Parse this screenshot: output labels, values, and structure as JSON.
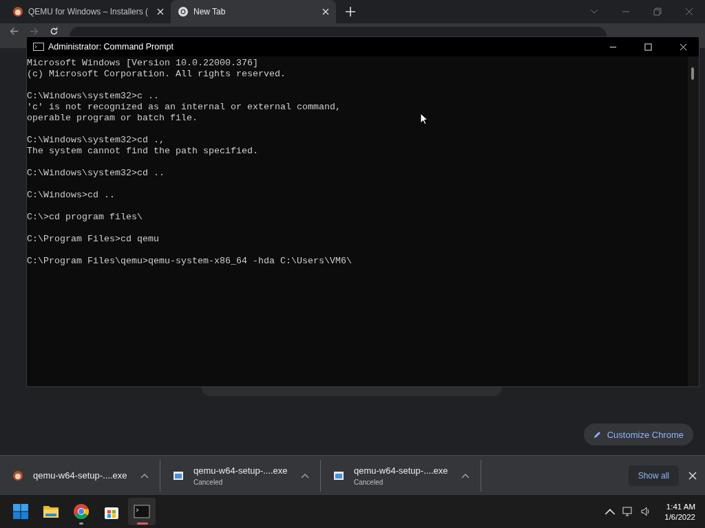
{
  "browser": {
    "tabs": [
      {
        "title": "QEMU for Windows – Installers (",
        "kind": "qemu",
        "selected": false
      },
      {
        "title": "New Tab",
        "kind": "chrome",
        "selected": true
      }
    ],
    "customize_button": "Customize Chrome"
  },
  "console_window": {
    "title": "Administrator: Command Prompt",
    "blocks": [
      [
        "Microsoft Windows [Version 10.0.22000.376]",
        "(c) Microsoft Corporation. All rights reserved."
      ],
      [
        "C:\\Windows\\system32>c ..",
        "'c' is not recognized as an internal or external command,",
        "operable program or batch file."
      ],
      [
        "C:\\Windows\\system32>cd .,",
        "The system cannot find the path specified."
      ],
      [
        "C:\\Windows\\system32>cd .."
      ],
      [
        "C:\\Windows>cd .."
      ],
      [
        "C:\\>cd program files\\"
      ],
      [
        "C:\\Program Files>cd qemu"
      ],
      [
        "C:\\Program Files\\qemu>qemu-system-x86_64 -hda C:\\Users\\VM6\\"
      ]
    ]
  },
  "downloads": {
    "items": [
      {
        "name": "qemu-w64-setup-....exe",
        "kind": "qemu"
      },
      {
        "name": "qemu-w64-setup-....exe",
        "status": "Canceled",
        "kind": "file"
      },
      {
        "name": "qemu-w64-setup-....exe",
        "status": "Canceled",
        "kind": "file"
      }
    ],
    "show_all": "Show all"
  },
  "taskbar": {
    "apps": [
      {
        "kind": "start",
        "active": false
      },
      {
        "kind": "folder",
        "active": false
      },
      {
        "kind": "chrome",
        "active": false,
        "running": true
      },
      {
        "kind": "store",
        "active": false
      },
      {
        "kind": "terminal",
        "active": true
      }
    ],
    "time": "1:41 AM",
    "date": "1/6/2022"
  }
}
